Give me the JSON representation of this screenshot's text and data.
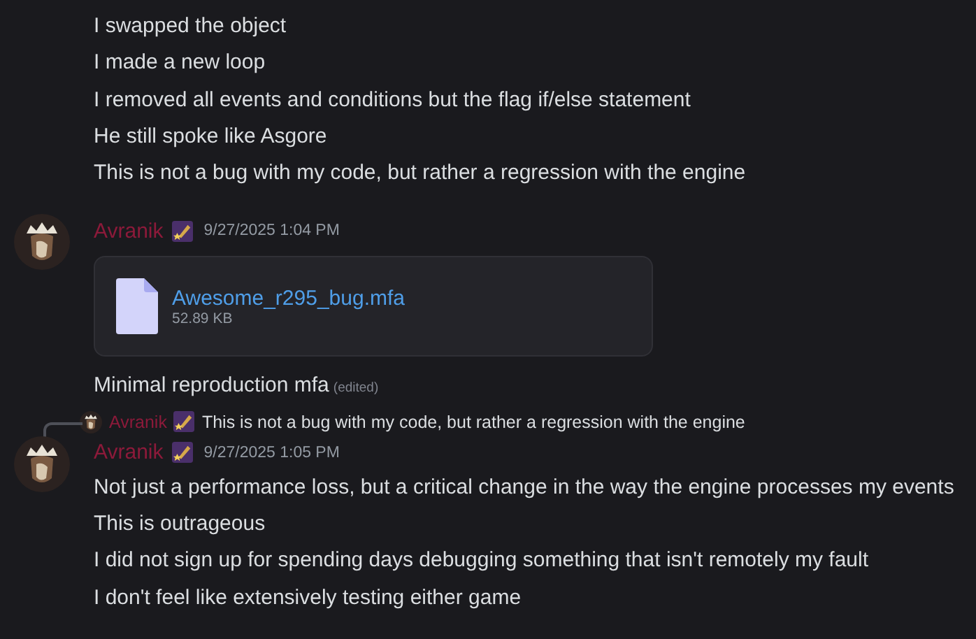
{
  "messages": [
    {
      "kind": "continuation",
      "lines": [
        {
          "text": "I swapped the object"
        },
        {
          "text": "I made a new loop"
        },
        {
          "text": "I removed all events and conditions but the flag if/else statement"
        },
        {
          "text": "He still spoke like Asgore"
        },
        {
          "text": "This is not a bug with my code, but rather a regression with the engine"
        }
      ]
    },
    {
      "kind": "header",
      "author": "Avranik",
      "timestamp": "9/27/2025 1:04 PM",
      "attachment": {
        "filename": "Awesome_r295_bug.mfa",
        "size": "52.89 KB"
      },
      "lines": [
        {
          "text": "Minimal reproduction mfa",
          "edited": "(edited)"
        }
      ]
    },
    {
      "kind": "header",
      "author": "Avranik",
      "timestamp": "9/27/2025 1:05 PM",
      "reply": {
        "author": "Avranik",
        "text": "This is not a bug with my code, but rather a regression with the engine"
      },
      "lines": [
        {
          "text": "Not just a performance loss, but a critical change in the way the engine processes my events"
        },
        {
          "text": "This is outrageous"
        },
        {
          "text": "I did not sign up for spending days debugging something that isn't remotely my fault"
        },
        {
          "text": "I don't feel like extensively testing either game"
        }
      ]
    }
  ]
}
